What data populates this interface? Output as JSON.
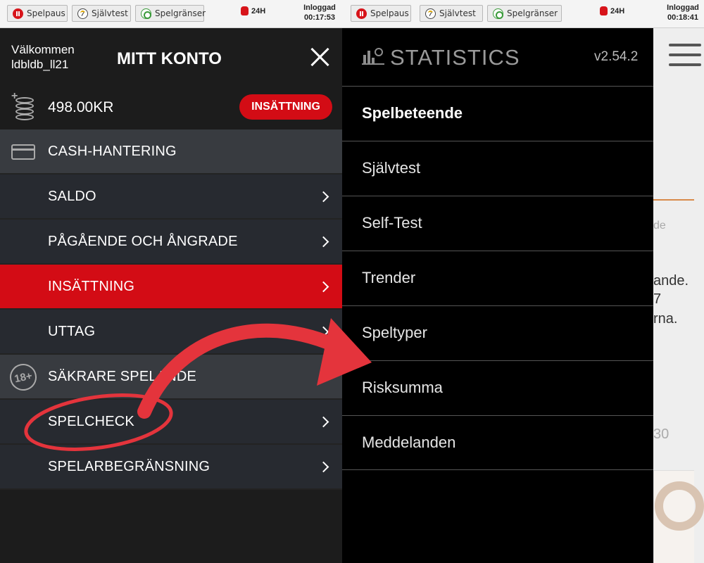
{
  "left_topbar": {
    "pause_label": "Spelpaus",
    "selftest_label": "Självtest",
    "limits_label": "Spelgränser",
    "timer_label": "24H",
    "login_label": "Inloggad",
    "login_time": "00:17:53"
  },
  "right_topbar": {
    "pause_label": "Spelpaus",
    "selftest_label": "Självtest",
    "limits_label": "Spelgränser",
    "timer_label": "24H",
    "login_label": "Inloggad",
    "login_time": "00:18:41"
  },
  "account": {
    "welcome": "Välkommen",
    "username": "ldbldb_ll21",
    "title": "MITT KONTO",
    "balance": "498.00KR",
    "deposit_button": "INSÄTTNING"
  },
  "menu": {
    "cash_section": "CASH-HANTERING",
    "saldo": "SALDO",
    "pending": "PÅGÅENDE OCH ÅNGRADE",
    "deposit": "INSÄTTNING",
    "withdraw": "UTTAG",
    "safe_section": "SÄKRARE SPELANDE",
    "spelcheck": "SPELCHECK",
    "limit": "SPELARBEGRÄNSNING",
    "age_badge": "18+"
  },
  "statistics": {
    "title": "STATISTICS",
    "version": "v2.54.2",
    "items": [
      "Spelbeteende",
      "Självtest",
      "Self-Test",
      "Trender",
      "Speltyper",
      "Risksumma",
      "Meddelanden"
    ]
  },
  "background_peek": {
    "line1": "de",
    "line2": "ande.",
    "line3": "7",
    "line4": "rna.",
    "line5": "30"
  },
  "colors": {
    "brand_red": "#d30c15",
    "annotation_red": "#e4343c"
  }
}
